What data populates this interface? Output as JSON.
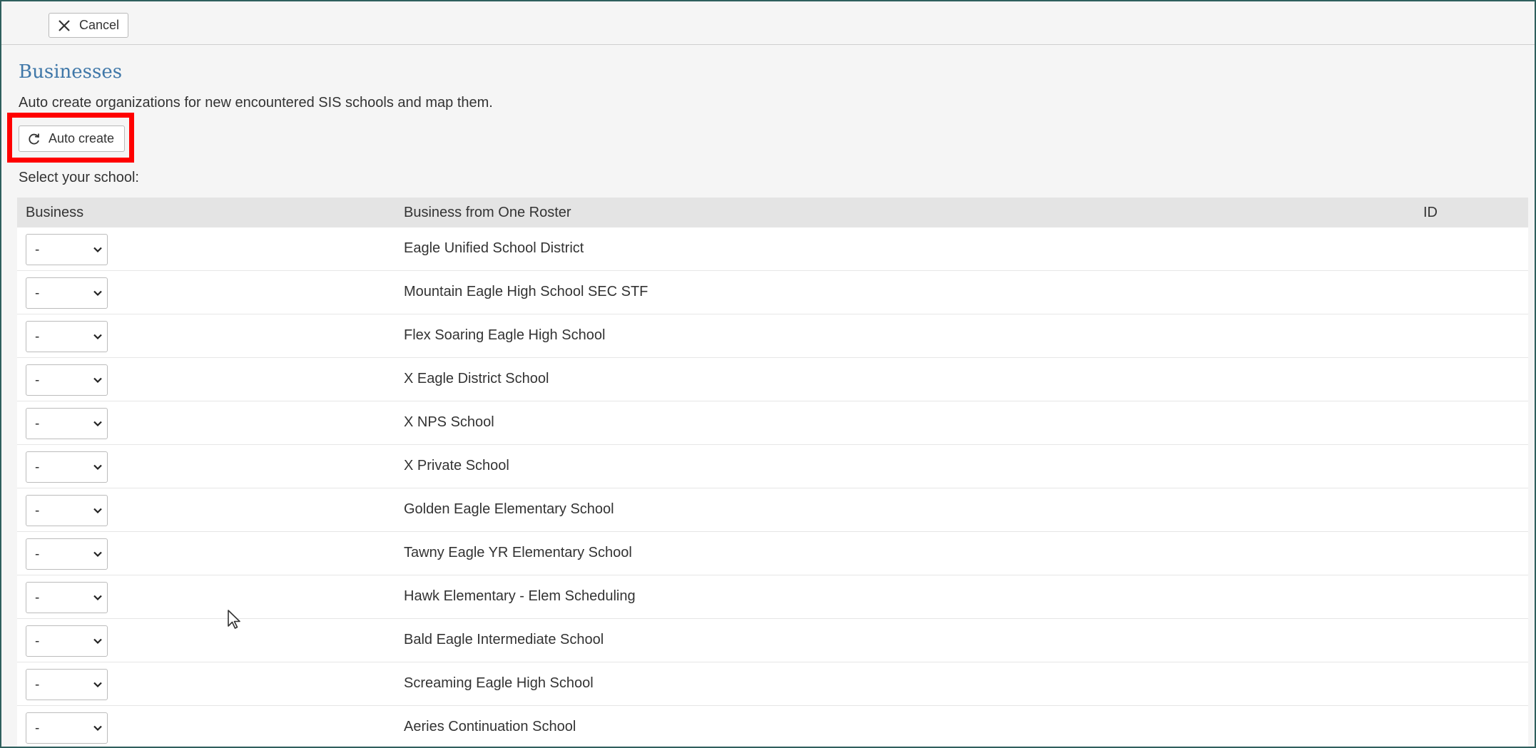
{
  "toolbar": {
    "cancel_label": "Cancel",
    "cancel_icon": "close-icon"
  },
  "section": {
    "title": "Businesses",
    "description": "Auto create organizations for new encountered SIS schools and map them.",
    "auto_create_label": "Auto create",
    "auto_create_icon": "refresh-icon",
    "select_label": "Select your school:"
  },
  "table": {
    "headers": [
      "Business",
      "Business from One Roster",
      "ID"
    ],
    "rows": [
      {
        "selected": "-",
        "name": "Eagle Unified School District"
      },
      {
        "selected": "-",
        "name": "Mountain Eagle High School SEC STF"
      },
      {
        "selected": "-",
        "name": "Flex Soaring Eagle High School"
      },
      {
        "selected": "-",
        "name": "X Eagle District School"
      },
      {
        "selected": "-",
        "name": "X NPS School"
      },
      {
        "selected": "-",
        "name": "X Private School"
      },
      {
        "selected": "-",
        "name": "Golden Eagle Elementary School"
      },
      {
        "selected": "-",
        "name": "Tawny Eagle YR Elementary School"
      },
      {
        "selected": "-",
        "name": "Hawk Elementary - Elem Scheduling"
      },
      {
        "selected": "-",
        "name": "Bald Eagle Intermediate School"
      },
      {
        "selected": "-",
        "name": "Screaming Eagle High School"
      },
      {
        "selected": "-",
        "name": "Aeries Continuation School"
      }
    ]
  },
  "colors": {
    "title": "#3f77a8",
    "highlight": "#ff0000",
    "frame_border": "#2f5f5d",
    "header_bg": "#e4e4e4"
  }
}
